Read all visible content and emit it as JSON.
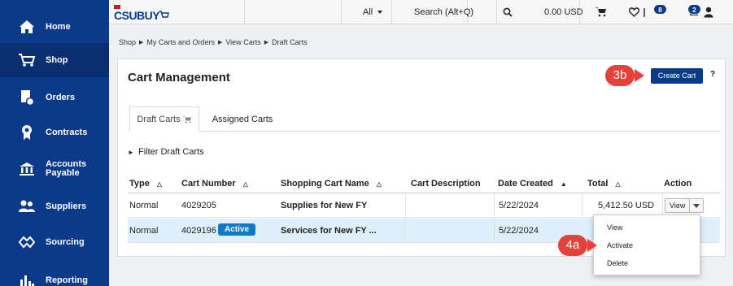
{
  "sidebar": {
    "items": [
      {
        "label": "Home",
        "icon": "home-icon"
      },
      {
        "label": "Shop",
        "icon": "cart-icon"
      },
      {
        "label": "Orders",
        "icon": "orders-icon"
      },
      {
        "label": "Contracts",
        "icon": "contract-icon"
      },
      {
        "label": "Accounts",
        "label2": "Payable",
        "icon": "bank-icon"
      },
      {
        "label": "Suppliers",
        "icon": "suppliers-icon"
      },
      {
        "label": "Sourcing",
        "icon": "sourcing-icon"
      },
      {
        "label": "Reporting",
        "icon": "reporting-icon"
      }
    ],
    "active_index": 1
  },
  "topbar": {
    "logo_text": "CSUBUY",
    "search_scope": "All",
    "search_placeholder": "Search (Alt+Q)",
    "cart_total": "0.00 USD",
    "notification_count": "8",
    "messages_count": "2"
  },
  "breadcrumb": [
    "Shop",
    "My Carts and Orders",
    "View Carts",
    "Draft Carts"
  ],
  "card": {
    "title": "Cart Management",
    "create_cart_label": "Create Cart",
    "help_label": "?",
    "tabs": [
      {
        "label": "Draft Carts"
      },
      {
        "label": "Assigned Carts"
      }
    ],
    "filter_label": "Filter Draft Carts"
  },
  "table": {
    "headers": [
      "Type",
      "Cart Number",
      "Shopping Cart Name",
      "Cart Description",
      "Date Created",
      "Total",
      "Action"
    ],
    "rows": [
      {
        "type": "Normal",
        "cart_number": "4029205",
        "name": "Supplies for New FY",
        "description": "",
        "date": "5/22/2024",
        "total": "5,412.50 USD",
        "action": "View"
      },
      {
        "type": "Normal",
        "cart_number": "4029196",
        "badge": "Active",
        "name": "Services for New FY ...",
        "description": "",
        "date": "5/22/2024",
        "total": "",
        "action": ""
      }
    ]
  },
  "menu": {
    "items": [
      "View",
      "Activate",
      "Delete"
    ]
  },
  "callouts": {
    "create": "3b",
    "activate": "4a"
  },
  "colors": {
    "sidebar": "#0b3a8a",
    "accent": "#0b3a8a",
    "active_badge": "#0e7ac4",
    "callout": "#e5413a",
    "selected_row": "#dff0fb"
  }
}
